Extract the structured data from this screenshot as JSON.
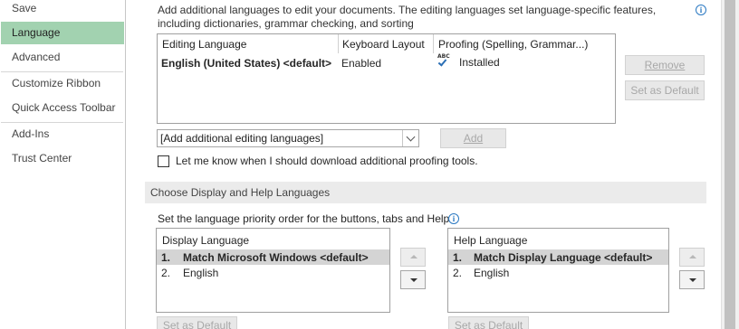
{
  "sidebar": {
    "items": [
      {
        "label": "Save"
      },
      {
        "label": "Language",
        "selected": true
      },
      {
        "label": "Advanced"
      },
      {
        "label": "Customize Ribbon"
      },
      {
        "label": "Quick Access Toolbar"
      },
      {
        "label": "Add-Ins"
      },
      {
        "label": "Trust Center"
      }
    ]
  },
  "editing": {
    "intro": "Add additional languages to edit your documents. The editing languages set language-specific features, including dictionaries, grammar checking, and sorting",
    "columns": [
      "Editing Language",
      "Keyboard Layout",
      "Proofing (Spelling, Grammar...)"
    ],
    "rows": [
      {
        "language": "English (United States) <default>",
        "keyboard": "Enabled",
        "proofing": "Installed",
        "proofing_icon": "abc-check-icon"
      }
    ],
    "abc_text": "ABC",
    "remove_label": "Remove",
    "set_default_label": "Set as Default",
    "add_combo_value": "[Add additional editing languages]",
    "add_label": "Add",
    "proofing_checkbox_label": "Let me know when I should download additional proofing tools.",
    "proofing_checkbox_checked": false
  },
  "display_help": {
    "section_title": "Choose Display and Help Languages",
    "priority_text": "Set the language priority order for the buttons, tabs and Help",
    "display": {
      "header": "Display Language",
      "items": [
        {
          "num": "1.",
          "label": "Match Microsoft Windows <default>",
          "selected": true
        },
        {
          "num": "2.",
          "label": "English",
          "selected": false
        }
      ],
      "set_default_label": "Set as Default"
    },
    "help": {
      "header": "Help Language",
      "items": [
        {
          "num": "1.",
          "label": "Match Display Language <default>",
          "selected": true
        },
        {
          "num": "2.",
          "label": "English",
          "selected": false
        }
      ],
      "set_default_label": "Set as Default"
    }
  },
  "colors": {
    "nav_selected": "#a2d2b0",
    "info_blue": "#2b79c2",
    "section_bg": "#ebebeb",
    "disabled_text": "#a8a8a8"
  }
}
